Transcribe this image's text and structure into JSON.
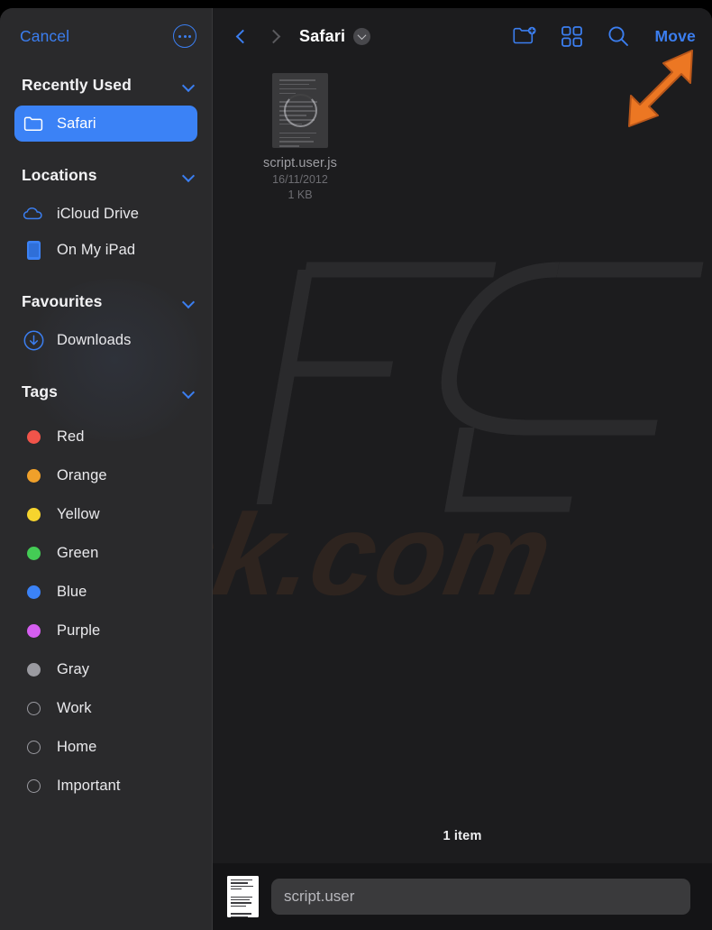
{
  "sidebar": {
    "cancel_label": "Cancel",
    "more_icon": "ellipsis-circle-icon",
    "groups": [
      {
        "title": "Recently Used",
        "chevron_icon": "chevron-down-icon",
        "items": [
          {
            "label": "Safari",
            "icon": "folder-icon",
            "selected": true
          }
        ]
      },
      {
        "title": "Locations",
        "chevron_icon": "chevron-down-icon",
        "items": [
          {
            "label": "iCloud Drive",
            "icon": "cloud-icon",
            "selected": false
          },
          {
            "label": "On My iPad",
            "icon": "ipad-icon",
            "selected": false
          }
        ]
      },
      {
        "title": "Favourites",
        "chevron_icon": "chevron-down-icon",
        "items": [
          {
            "label": "Downloads",
            "icon": "download-circle-icon",
            "selected": false
          }
        ]
      },
      {
        "title": "Tags",
        "chevron_icon": "chevron-down-icon",
        "items": [
          {
            "label": "Red",
            "icon": "tag-dot-icon",
            "color": "#f1544a"
          },
          {
            "label": "Orange",
            "icon": "tag-dot-icon",
            "color": "#f0a02a"
          },
          {
            "label": "Yellow",
            "icon": "tag-dot-icon",
            "color": "#f6d42e"
          },
          {
            "label": "Green",
            "icon": "tag-dot-icon",
            "color": "#44cc55"
          },
          {
            "label": "Blue",
            "icon": "tag-dot-icon",
            "color": "#3b82f6"
          },
          {
            "label": "Purple",
            "icon": "tag-dot-icon",
            "color": "#d55ef0"
          },
          {
            "label": "Gray",
            "icon": "tag-dot-icon",
            "color": "#9a9aa0"
          },
          {
            "label": "Work",
            "icon": "tag-dot-hollow-icon",
            "color": null
          },
          {
            "label": "Home",
            "icon": "tag-dot-hollow-icon",
            "color": null
          },
          {
            "label": "Important",
            "icon": "tag-dot-hollow-icon",
            "color": null
          }
        ]
      }
    ]
  },
  "toolbar": {
    "back_icon": "chevron-left-icon",
    "forward_icon": "chevron-right-icon",
    "breadcrumb_title": "Safari",
    "breadcrumb_chevron_icon": "chevron-down-icon",
    "new_folder_icon": "new-folder-icon",
    "grid_view_icon": "grid-view-icon",
    "search_icon": "search-icon",
    "move_label": "Move"
  },
  "files": [
    {
      "name": "script.user.js",
      "date": "16/11/2012",
      "size": "1 KB",
      "thumbnail_icon": "document-thumbnail-icon",
      "loading_icon": "spinner-icon"
    }
  ],
  "status": {
    "item_count": "1 item"
  },
  "name_bar": {
    "thumbnail_icon": "document-thumbnail-icon",
    "filename_value": "script.user",
    "filename_placeholder": "script.user"
  },
  "annotation": {
    "arrow_icon": "arrow-up-right-annotation-icon",
    "arrow_color": "#ec7723"
  },
  "watermark": {
    "text": "PCrisk.com"
  },
  "colors": {
    "accent": "#3b7ef0",
    "selection": "#3b82f6",
    "sidebar_bg": "#2a2a2c",
    "main_bg": "#1c1c1e",
    "name_bar_bg": "#141416"
  }
}
